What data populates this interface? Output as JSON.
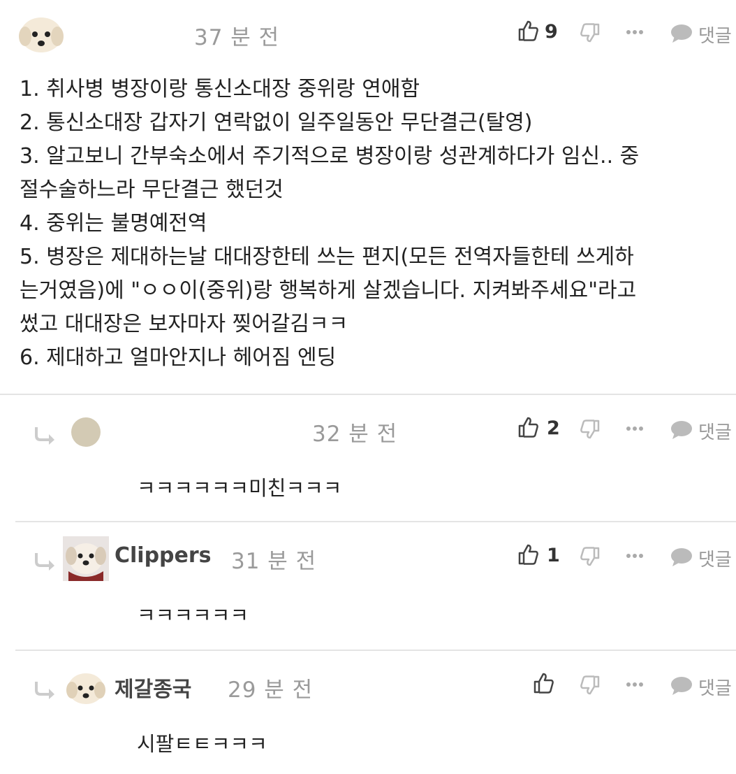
{
  "comments": [
    {
      "time": "37 분 전",
      "likes": "9",
      "reply_label": "댓글",
      "body_lines": [
        "1. 취사병 병장이랑 통신소대장 중위랑 연애함",
        "2. 통신소대장 갑자기 연락없이 일주일동안 무단결근(탈영)",
        "3. 알고보니 간부숙소에서 주기적으로 병장이랑 성관계하다가 임신.. 중",
        "절수술하느라 무단결근 했던것",
        "4. 중위는 불명예전역",
        "5. 병장은 제대하는날 대대장한테 쓰는 편지(모든 전역자들한테 쓰게하",
        "는거였음)에 \"ㅇㅇ이(중위)랑 행복하게 살겠습니다. 지켜봐주세요\"라고",
        "썼고 대대장은 보자마자 찢어갈김ㅋㅋ",
        "6. 제대하고 얼마안지나 헤어짐 엔딩"
      ]
    },
    {
      "time": "32 분 전",
      "likes": "2",
      "reply_label": "댓글",
      "text": "ㅋㅋㅋㅋㅋㅋ미친ㅋㅋㅋ"
    },
    {
      "username": "Clippers",
      "time": "31 분 전",
      "likes": "1",
      "reply_label": "댓글",
      "text": "ㅋㅋㅋㅋㅋㅋ"
    },
    {
      "username": "제갈종국",
      "time": "29 분 전",
      "likes": "",
      "reply_label": "댓글",
      "text": "시팔ㅌㅌㅋㅋㅋ"
    }
  ],
  "icons": {
    "like": "thumbs-up-icon",
    "dislike": "thumbs-down-icon",
    "more": "more-dots-icon",
    "reply": "speech-bubble-icon",
    "reply_arrow": "reply-arrow-icon"
  }
}
